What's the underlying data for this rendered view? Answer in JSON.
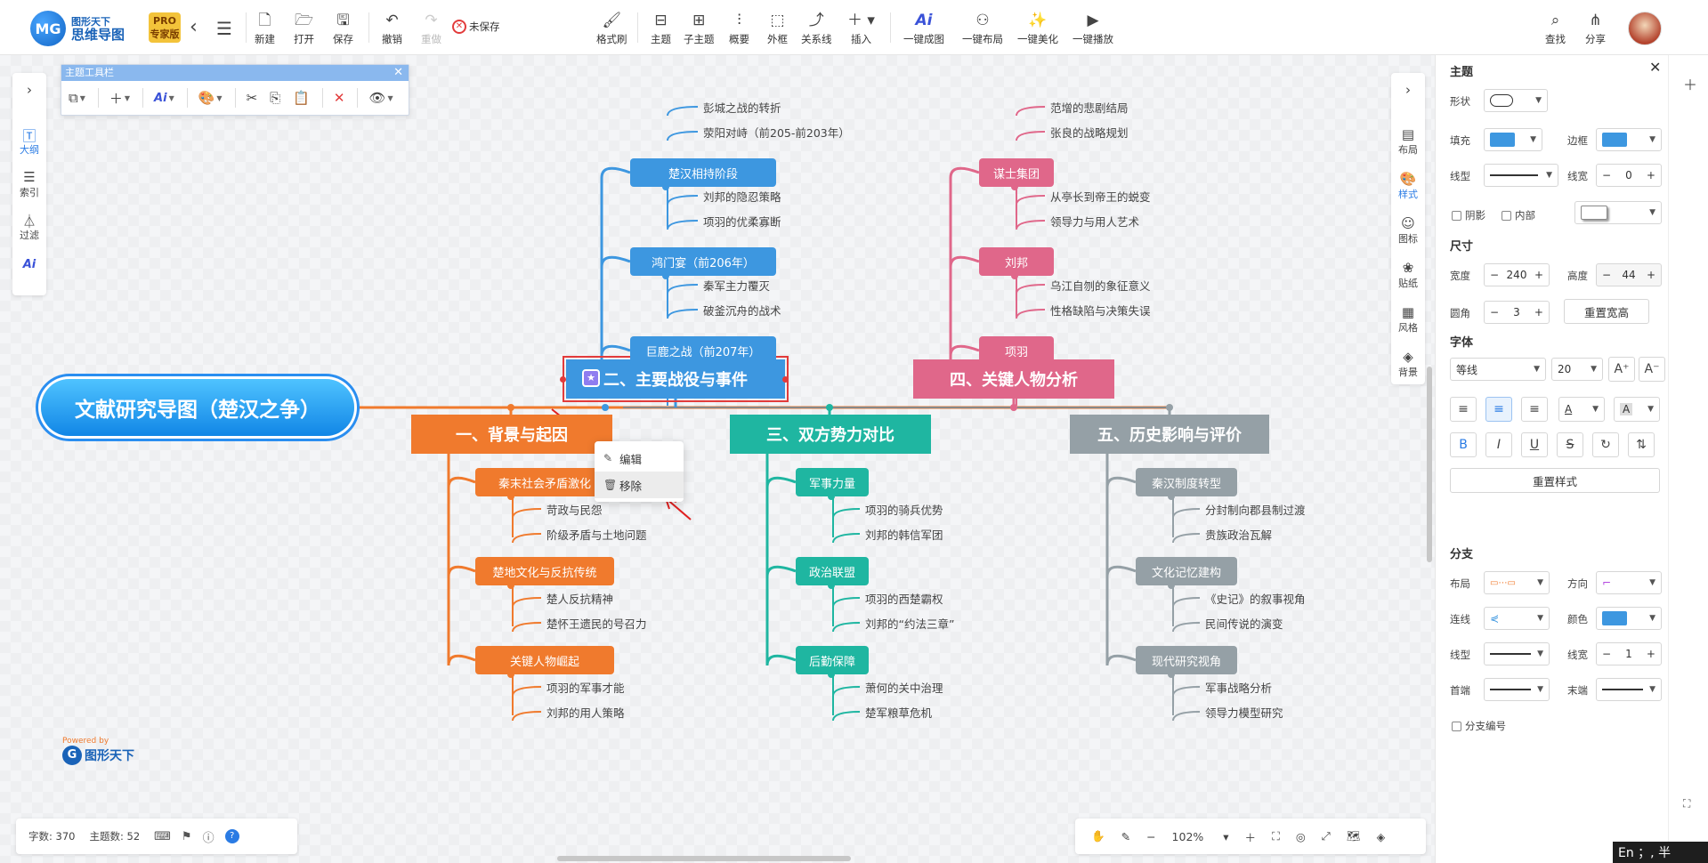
{
  "app": {
    "logo_top": "图形天下",
    "logo_bottom": "思维导图",
    "pro_top": "PRO",
    "pro_bottom": "专家版",
    "unsaved": "未保存"
  },
  "toolbar": {
    "new": "新建",
    "open": "打开",
    "save": "保存",
    "undo": "撤销",
    "redo": "重做",
    "format_painter": "格式刷",
    "topic": "主题",
    "subtopic": "子主题",
    "summary": "概要",
    "boundary": "外框",
    "relation": "关系线",
    "insert": "插入",
    "ai_generate": "一键成图",
    "ai_layout": "一键布局",
    "ai_beautify": "一键美化",
    "ai_play": "一键播放",
    "find": "查找",
    "share": "分享"
  },
  "theme_toolbar": {
    "title": "主题工具栏"
  },
  "left_bar": {
    "outline": "大纲",
    "index": "索引",
    "filter": "过滤"
  },
  "right_mini": {
    "layout": "布局",
    "style": "样式",
    "icon": "图标",
    "sticker": "贴纸",
    "theme": "风格",
    "background": "背景"
  },
  "mindmap": {
    "root": "文献研究导图（楚汉之争）",
    "branches": [
      {
        "title": "一、背景与起因",
        "children": [
          {
            "title": "秦末社会矛盾激化",
            "leaves": [
              "苛政与民怨",
              "阶级矛盾与土地问题"
            ]
          },
          {
            "title": "楚地文化与反抗传统",
            "leaves": [
              "楚人反抗精神",
              "楚怀王遗民的号召力"
            ]
          },
          {
            "title": "关键人物崛起",
            "leaves": [
              "项羽的军事才能",
              "刘邦的用人策略"
            ]
          }
        ]
      },
      {
        "title": "二、主要战役与事件",
        "children": [
          {
            "title": "楚汉相持阶段",
            "leaves": [
              "彭城之战的转折",
              "荥阳对峙（前205-前203年）"
            ]
          },
          {
            "title": "鸿门宴（前206年）",
            "leaves": [
              "刘邦的隐忍策略",
              "项羽的优柔寡断"
            ]
          },
          {
            "title": "巨鹿之战（前207年）",
            "leaves": [
              "秦军主力覆灭",
              "破釜沉舟的战术"
            ]
          }
        ]
      },
      {
        "title": "三、双方势力对比",
        "children": [
          {
            "title": "军事力量",
            "leaves": [
              "项羽的骑兵优势",
              "刘邦的韩信军团"
            ]
          },
          {
            "title": "政治联盟",
            "leaves": [
              "项羽的西楚霸权",
              "刘邦的“约法三章”"
            ]
          },
          {
            "title": "后勤保障",
            "leaves": [
              "萧何的关中治理",
              "楚军粮草危机"
            ]
          }
        ]
      },
      {
        "title": "四、关键人物分析",
        "children": [
          {
            "title": "谋士集团",
            "leaves": [
              "范增的悲剧结局",
              "张良的战略规划"
            ]
          },
          {
            "title": "刘邦",
            "leaves": [
              "从亭长到帝王的蜕变",
              "领导力与用人艺术"
            ]
          },
          {
            "title": "项羽",
            "leaves": [
              "乌江自刎的象征意义",
              "性格缺陷与决策失误"
            ]
          }
        ]
      },
      {
        "title": "五、历史影响与评价",
        "children": [
          {
            "title": "秦汉制度转型",
            "leaves": [
              "分封制向郡县制过渡",
              "贵族政治瓦解"
            ]
          },
          {
            "title": "文化记忆建构",
            "leaves": [
              "《史记》的叙事视角",
              "民间传说的演变"
            ]
          },
          {
            "title": "现代研究视角",
            "leaves": [
              "军事战略分析",
              "领导力模型研究"
            ]
          }
        ]
      }
    ],
    "colors": {
      "orange": "#f07a2d",
      "blue": "#3d97e0",
      "teal": "#1fb6a1",
      "pink": "#e0678a",
      "gray": "#95a0a6"
    }
  },
  "context_menu": {
    "edit": "编辑",
    "remove": "移除"
  },
  "powered": {
    "line1": "Powered by",
    "line2": "图形天下"
  },
  "status": {
    "words": "字数: 370",
    "topics": "主题数: 52",
    "help": "?"
  },
  "zoom": {
    "value": "102%"
  },
  "panel": {
    "title": "主题",
    "shape": "形状",
    "fill": "填充",
    "border": "边框",
    "line_type": "线型",
    "line_width": "线宽",
    "line_width_value": "0",
    "shadow": "阴影",
    "inner": "内部",
    "size": "尺寸",
    "width": "宽度",
    "width_value": "240",
    "height": "高度",
    "height_value": "44",
    "radius": "圆角",
    "radius_value": "3",
    "reset_size": "重置宽高",
    "font": "字体",
    "font_family": "等线",
    "font_size": "20",
    "reset_style": "重置样式",
    "branch": "分支",
    "layout": "布局",
    "direction": "方向",
    "connector": "连线",
    "color": "颜色",
    "b_line_type": "线型",
    "b_line_width": "线宽",
    "b_line_width_value": "1",
    "start": "首端",
    "end": "末端",
    "branch_number": "分支编号",
    "accent": "#3d97e0"
  },
  "ime": {
    "text": "En ；, 半"
  }
}
